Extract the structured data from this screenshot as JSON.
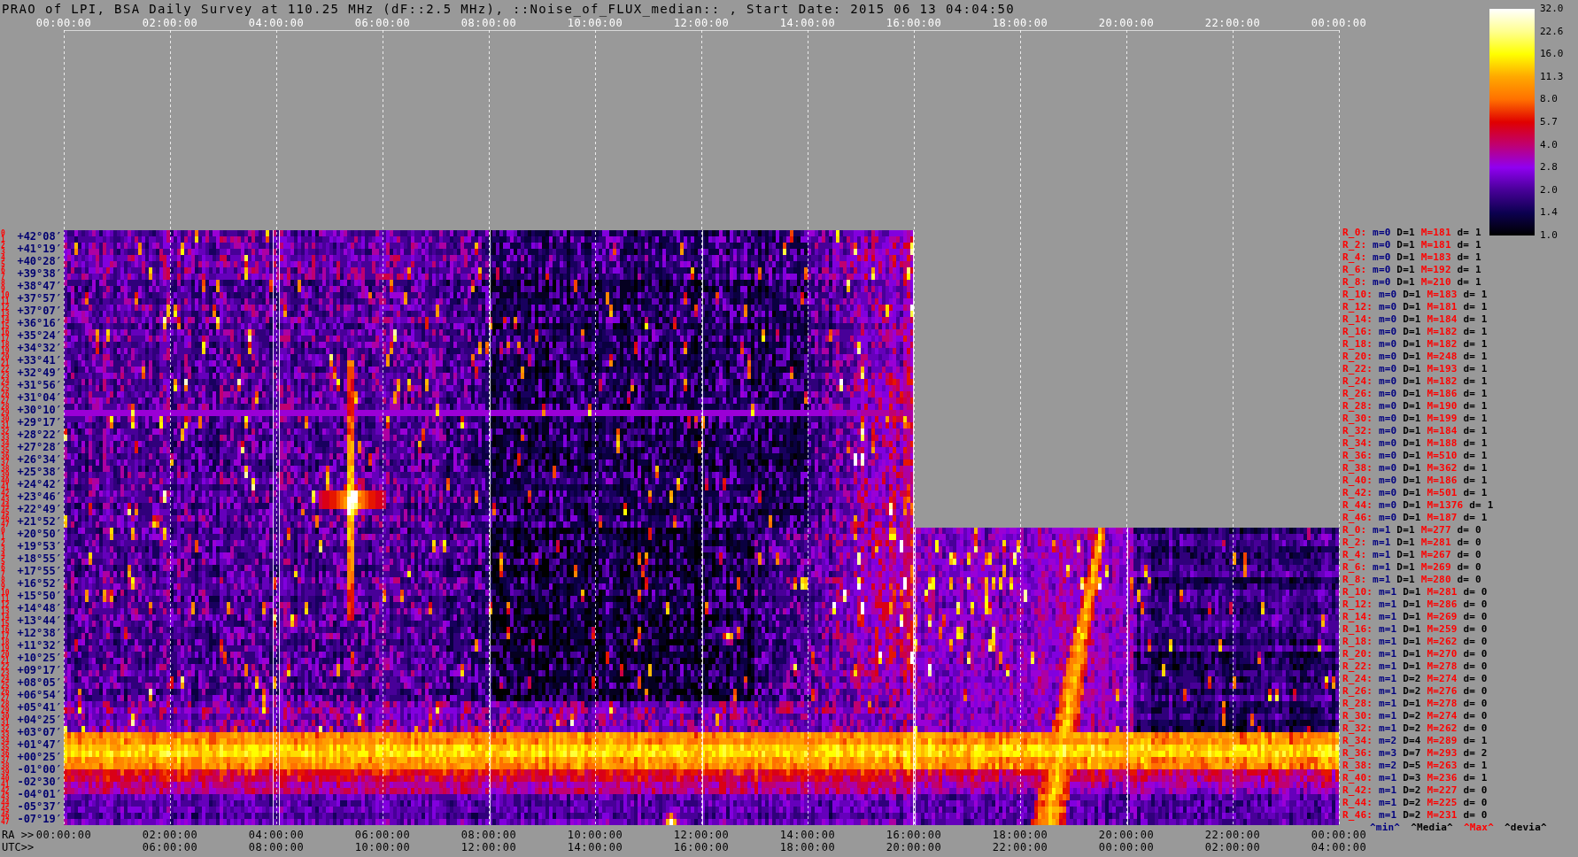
{
  "title": "PRAO of LPI, BSA Daily Survey at 110.25 MHz (dF::2.5 MHz), ::Noise_of_FLUX_median:: , Start Date: 2015 06 13 04:04:50",
  "top_axis": {
    "ticks": [
      "00:00:00",
      "02:00:00",
      "04:00:00",
      "06:00:00",
      "08:00:00",
      "10:00:00",
      "12:00:00",
      "14:00:00",
      "16:00:00",
      "18:00:00",
      "20:00:00",
      "22:00:00",
      "00:00:00"
    ]
  },
  "colorbar": {
    "ticks": [
      "32.0",
      "22.6",
      "16.0",
      "11.3",
      "8.0",
      "5.7",
      "4.0",
      "2.8",
      "2.0",
      "1.4",
      "1.0"
    ]
  },
  "declination_labels": [
    "+42°08′",
    "+41°19′",
    "+40°28′",
    "+39°38′",
    "+38°47′",
    "+37°57′",
    "+37°07′",
    "+36°16′",
    "+35°24′",
    "+34°32′",
    "+33°41′",
    "+32°49′",
    "+31°56′",
    "+31°04′",
    "+30°10′",
    "+29°17′",
    "+28°22′",
    "+27°28′",
    "+26°34′",
    "+25°38′",
    "+24°42′",
    "+23°46′",
    "+22°49′",
    "+21°52′",
    "+20°50′",
    "+19°53′",
    "+18°55′",
    "+17°55′",
    "+16°52′",
    "+15°50′",
    "+14°48′",
    "+13°44′",
    "+12°38′",
    "+11°32′",
    "+10°25′",
    "+09°17′",
    "+08°05′",
    "+06°54′",
    "+05°41′",
    "+04°25′",
    "+03°07′",
    "+01°47′",
    "+00°25′",
    "-01°00′",
    "-02°30′",
    "-04°01′",
    "-05°37′",
    "-07°19′"
  ],
  "beam_sets": [
    {
      "row_indices": [
        "0",
        "1",
        "2",
        "3",
        "4",
        "5",
        "6",
        "7",
        "8",
        "9",
        "10",
        "11",
        "12",
        "13",
        "14",
        "15",
        "16",
        "17",
        "18",
        "19",
        "20",
        "21",
        "22",
        "23",
        "24",
        "25",
        "26",
        "27",
        "28",
        "29",
        "30",
        "31",
        "32",
        "33",
        "34",
        "35",
        "36",
        "37",
        "38",
        "39",
        "40",
        "41",
        "42",
        "43",
        "44",
        "45",
        "46",
        "47"
      ],
      "stats": [
        {
          "beam": "R_0:",
          "min": "m=0",
          "median": "D=1",
          "max": "M=181",
          "deviation": "d= 1"
        },
        {
          "beam": "R_2:",
          "min": "m=0",
          "median": "D=1",
          "max": "M=181",
          "deviation": "d= 1"
        },
        {
          "beam": "R_4:",
          "min": "m=0",
          "median": "D=1",
          "max": "M=183",
          "deviation": "d= 1"
        },
        {
          "beam": "R_6:",
          "min": "m=0",
          "median": "D=1",
          "max": "M=192",
          "deviation": "d= 1"
        },
        {
          "beam": "R_8:",
          "min": "m=0",
          "median": "D=1",
          "max": "M=210",
          "deviation": "d= 1"
        },
        {
          "beam": "R_10:",
          "min": "m=0",
          "median": "D=1",
          "max": "M=183",
          "deviation": "d= 1"
        },
        {
          "beam": "R_12:",
          "min": "m=0",
          "median": "D=1",
          "max": "M=181",
          "deviation": "d= 1"
        },
        {
          "beam": "R_14:",
          "min": "m=0",
          "median": "D=1",
          "max": "M=184",
          "deviation": "d= 1"
        },
        {
          "beam": "R_16:",
          "min": "m=0",
          "median": "D=1",
          "max": "M=182",
          "deviation": "d= 1"
        },
        {
          "beam": "R_18:",
          "min": "m=0",
          "median": "D=1",
          "max": "M=182",
          "deviation": "d= 1"
        },
        {
          "beam": "R_20:",
          "min": "m=0",
          "median": "D=1",
          "max": "M=248",
          "deviation": "d= 1"
        },
        {
          "beam": "R_22:",
          "min": "m=0",
          "median": "D=1",
          "max": "M=193",
          "deviation": "d= 1"
        },
        {
          "beam": "R_24:",
          "min": "m=0",
          "median": "D=1",
          "max": "M=182",
          "deviation": "d= 1"
        },
        {
          "beam": "R_26:",
          "min": "m=0",
          "median": "D=1",
          "max": "M=186",
          "deviation": "d= 1"
        },
        {
          "beam": "R_28:",
          "min": "m=0",
          "median": "D=1",
          "max": "M=190",
          "deviation": "d= 1"
        },
        {
          "beam": "R_30:",
          "min": "m=0",
          "median": "D=1",
          "max": "M=199",
          "deviation": "d= 1"
        },
        {
          "beam": "R_32:",
          "min": "m=0",
          "median": "D=1",
          "max": "M=184",
          "deviation": "d= 1"
        },
        {
          "beam": "R_34:",
          "min": "m=0",
          "median": "D=1",
          "max": "M=188",
          "deviation": "d= 1"
        },
        {
          "beam": "R_36:",
          "min": "m=0",
          "median": "D=1",
          "max": "M=510",
          "deviation": "d= 1"
        },
        {
          "beam": "R_38:",
          "min": "m=0",
          "median": "D=1",
          "max": "M=362",
          "deviation": "d= 1"
        },
        {
          "beam": "R_40:",
          "min": "m=0",
          "median": "D=1",
          "max": "M=186",
          "deviation": "d= 1"
        },
        {
          "beam": "R_42:",
          "min": "m=0",
          "median": "D=1",
          "max": "M=501",
          "deviation": "d= 1"
        },
        {
          "beam": "R_44:",
          "min": "m=0",
          "median": "D=1",
          "max": "M=1376",
          "deviation": "d= 1"
        },
        {
          "beam": "R_46:",
          "min": "m=0",
          "median": "D=1",
          "max": "M=187",
          "deviation": "d= 1"
        }
      ]
    },
    {
      "row_indices": [
        "0",
        "1",
        "2",
        "3",
        "4",
        "5",
        "6",
        "7",
        "8",
        "9",
        "10",
        "11",
        "12",
        "13",
        "14",
        "15",
        "16",
        "17",
        "18",
        "19",
        "20",
        "21",
        "22",
        "23",
        "24",
        "25",
        "26",
        "27",
        "28",
        "29",
        "30",
        "31",
        "32",
        "33",
        "34",
        "35",
        "36",
        "37",
        "38",
        "39",
        "40",
        "41",
        "42",
        "43",
        "44",
        "45",
        "46",
        "47"
      ],
      "stats": [
        {
          "beam": "R_0:",
          "min": "m=1",
          "median": "D=1",
          "max": "M=277",
          "deviation": "d= 0"
        },
        {
          "beam": "R_2:",
          "min": "m=1",
          "median": "D=1",
          "max": "M=281",
          "deviation": "d= 0"
        },
        {
          "beam": "R_4:",
          "min": "m=1",
          "median": "D=1",
          "max": "M=267",
          "deviation": "d= 0"
        },
        {
          "beam": "R_6:",
          "min": "m=1",
          "median": "D=1",
          "max": "M=269",
          "deviation": "d= 0"
        },
        {
          "beam": "R_8:",
          "min": "m=1",
          "median": "D=1",
          "max": "M=280",
          "deviation": "d= 0"
        },
        {
          "beam": "R_10:",
          "min": "m=1",
          "median": "D=1",
          "max": "M=281",
          "deviation": "d= 0"
        },
        {
          "beam": "R_12:",
          "min": "m=1",
          "median": "D=1",
          "max": "M=286",
          "deviation": "d= 0"
        },
        {
          "beam": "R_14:",
          "min": "m=1",
          "median": "D=1",
          "max": "M=269",
          "deviation": "d= 0"
        },
        {
          "beam": "R_16:",
          "min": "m=1",
          "median": "D=1",
          "max": "M=259",
          "deviation": "d= 0"
        },
        {
          "beam": "R_18:",
          "min": "m=1",
          "median": "D=1",
          "max": "M=262",
          "deviation": "d= 0"
        },
        {
          "beam": "R_20:",
          "min": "m=1",
          "median": "D=1",
          "max": "M=270",
          "deviation": "d= 0"
        },
        {
          "beam": "R_22:",
          "min": "m=1",
          "median": "D=1",
          "max": "M=278",
          "deviation": "d= 0"
        },
        {
          "beam": "R_24:",
          "min": "m=1",
          "median": "D=2",
          "max": "M=274",
          "deviation": "d= 0"
        },
        {
          "beam": "R_26:",
          "min": "m=1",
          "median": "D=2",
          "max": "M=276",
          "deviation": "d= 0"
        },
        {
          "beam": "R_28:",
          "min": "m=1",
          "median": "D=1",
          "max": "M=278",
          "deviation": "d= 0"
        },
        {
          "beam": "R_30:",
          "min": "m=1",
          "median": "D=2",
          "max": "M=274",
          "deviation": "d= 0"
        },
        {
          "beam": "R_32:",
          "min": "m=1",
          "median": "D=2",
          "max": "M=262",
          "deviation": "d= 0"
        },
        {
          "beam": "R_34:",
          "min": "m=2",
          "median": "D=4",
          "max": "M=289",
          "deviation": "d= 1"
        },
        {
          "beam": "R_36:",
          "min": "m=3",
          "median": "D=7",
          "max": "M=293",
          "deviation": "d= 2"
        },
        {
          "beam": "R_38:",
          "min": "m=2",
          "median": "D=5",
          "max": "M=263",
          "deviation": "d= 1"
        },
        {
          "beam": "R_40:",
          "min": "m=1",
          "median": "D=3",
          "max": "M=236",
          "deviation": "d= 1"
        },
        {
          "beam": "R_42:",
          "min": "m=1",
          "median": "D=2",
          "max": "M=227",
          "deviation": "d= 0"
        },
        {
          "beam": "R_44:",
          "min": "m=1",
          "median": "D=2",
          "max": "M=225",
          "deviation": "d= 0"
        },
        {
          "beam": "R_46:",
          "min": "m=1",
          "median": "D=2",
          "max": "M=231",
          "deviation": "d= 0"
        }
      ]
    }
  ],
  "legend": [
    {
      "kind": "min",
      "label": "^min^"
    },
    {
      "kind": "median",
      "label": "^Media^"
    },
    {
      "kind": "max",
      "label": "^Max^"
    },
    {
      "kind": "deviation",
      "label": "^devia^"
    }
  ],
  "bottom_axes": {
    "ra": {
      "prefix": "RA >>",
      "ticks": [
        "00:00:00",
        "02:00:00",
        "04:00:00",
        "06:00:00",
        "08:00:00",
        "10:00:00",
        "12:00:00",
        "14:00:00",
        "16:00:00",
        "18:00:00",
        "20:00:00",
        "22:00:00",
        "00:00:00"
      ]
    },
    "utc": {
      "prefix": "UTC>>",
      "ticks": [
        "06:00:00",
        "08:00:00",
        "10:00:00",
        "12:00:00",
        "14:00:00",
        "16:00:00",
        "18:00:00",
        "20:00:00",
        "22:00:00",
        "00:00:00",
        "02:00:00",
        "04:00:00"
      ]
    }
  }
}
